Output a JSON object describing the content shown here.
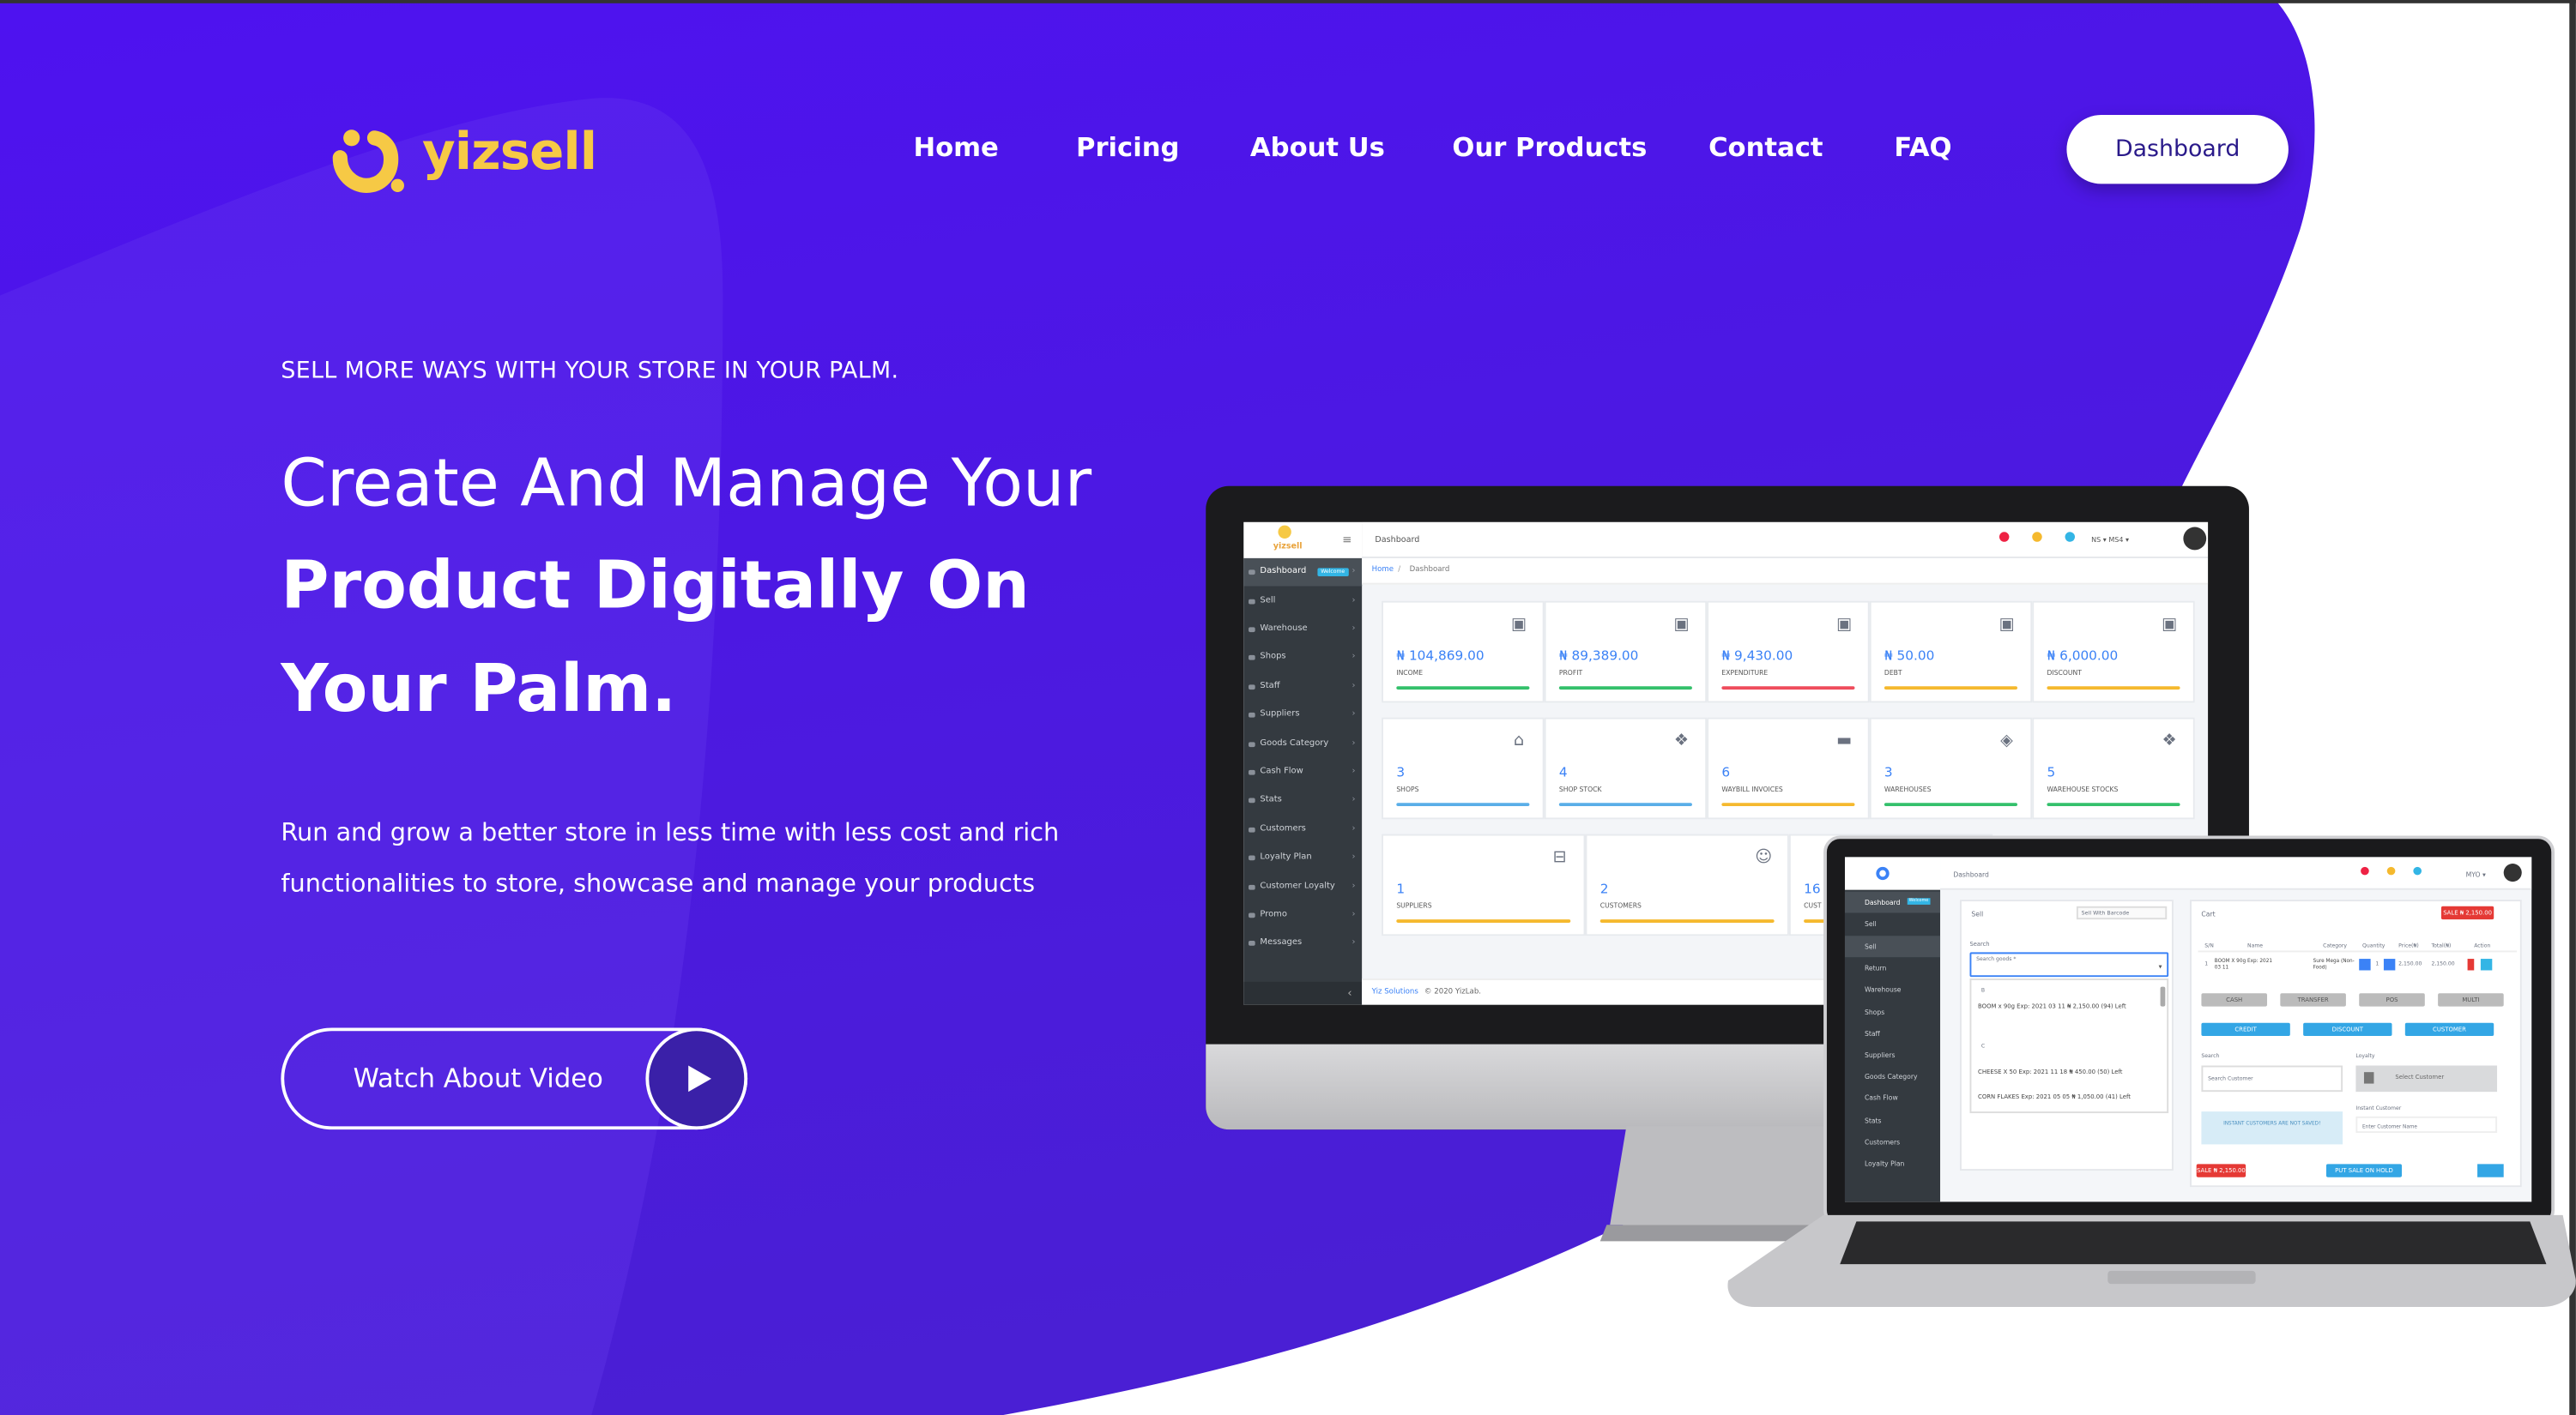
{
  "brand": {
    "name": "yizsell",
    "accent": "#f6c945"
  },
  "colors": {
    "primary": "#4b14e8",
    "button_text": "#2a1a8a"
  },
  "nav": {
    "items": [
      {
        "label": "Home"
      },
      {
        "label": "Pricing"
      },
      {
        "label": "About Us"
      },
      {
        "label": "Our Products"
      },
      {
        "label": "Contact"
      },
      {
        "label": "FAQ"
      }
    ],
    "cta": "Dashboard"
  },
  "hero": {
    "kicker": "SELL MORE WAYS WITH YOUR STORE IN YOUR PALM.",
    "title_line1": "Create And Manage Your",
    "title_line2": "Product Digitally On",
    "title_line3": "Your Palm.",
    "body_line1": "Run and grow a better store in less time with less cost and rich",
    "body_line2": "functionalities to store, showcase and manage your products",
    "video_button": "Watch About Video",
    "play_icon": "play-icon"
  },
  "desktop_app": {
    "logo_text": "yizsell",
    "header_title": "Dashboard",
    "header_right": "NS ▾   MS4 ▾",
    "breadcrumb_home": "Home",
    "breadcrumb_sep": "/",
    "breadcrumb_current": "Dashboard",
    "sidebar": [
      {
        "label": "Dashboard",
        "badge": "Welcome"
      },
      {
        "label": "Sell"
      },
      {
        "label": "Warehouse"
      },
      {
        "label": "Shops"
      },
      {
        "label": "Staff"
      },
      {
        "label": "Suppliers"
      },
      {
        "label": "Goods Category"
      },
      {
        "label": "Cash Flow"
      },
      {
        "label": "Stats"
      },
      {
        "label": "Customers"
      },
      {
        "label": "Loyalty Plan"
      },
      {
        "label": "Customer Loyalty"
      },
      {
        "label": "Promo"
      },
      {
        "label": "Messages"
      }
    ],
    "row1": [
      {
        "value": "₦ 104,869.00",
        "label": "INCOME",
        "color": "#34c06b"
      },
      {
        "value": "₦ 89,389.00",
        "label": "PROFIT",
        "color": "#34c06b"
      },
      {
        "value": "₦ 9,430.00",
        "label": "EXPENDITURE",
        "color": "#ef4c5c"
      },
      {
        "value": "₦ 50.00",
        "label": "DEBT",
        "color": "#f5b92e"
      },
      {
        "value": "₦ 6,000.00",
        "label": "DISCOUNT",
        "color": "#f5b92e"
      }
    ],
    "row2": [
      {
        "value": "3",
        "label": "SHOPS",
        "color": "#5aaee8"
      },
      {
        "value": "4",
        "label": "SHOP STOCK",
        "color": "#5aaee8"
      },
      {
        "value": "6",
        "label": "WAYBILL INVOICES",
        "color": "#f5b92e"
      },
      {
        "value": "3",
        "label": "WAREHOUSES",
        "color": "#34c06b"
      },
      {
        "value": "5",
        "label": "WAREHOUSE STOCKS",
        "color": "#34c06b"
      }
    ],
    "row3": [
      {
        "value": "1",
        "label": "SUPPLIERS",
        "color": "#f5b92e"
      },
      {
        "value": "2",
        "label": "CUSTOMERS",
        "color": "#f5b92e"
      },
      {
        "value": "16",
        "label": "CUST",
        "color": "#f5b92e"
      }
    ],
    "footer_link": "Yiz Solutions",
    "footer_text": "© 2020 YizLab."
  },
  "laptop_app": {
    "header_title": "Dashboard",
    "header_right": "MYO ▾",
    "sidebar": [
      {
        "label": "Dashboard",
        "badge": "Welcome"
      },
      {
        "label": "Sell"
      },
      {
        "label": "Sell"
      },
      {
        "label": "Return"
      },
      {
        "label": "Warehouse"
      },
      {
        "label": "Shops"
      },
      {
        "label": "Staff"
      },
      {
        "label": "Suppliers"
      },
      {
        "label": "Goods Category"
      },
      {
        "label": "Cash Flow"
      },
      {
        "label": "Stats"
      },
      {
        "label": "Customers"
      },
      {
        "label": "Loyalty Plan"
      }
    ],
    "sell_title": "Sell",
    "sell_barcode_placeholder": "Sell With Barcode",
    "search_label": "Search",
    "search_goods_label": "Search goods *",
    "dropdown_items": [
      {
        "group": "B",
        "text": "BOOM x 90g Exp: 2021 03 11 ₦ 2,150.00 (94) Left"
      },
      {
        "group": "C",
        "text": "CHEESE X 50 Exp: 2021 11 18 ₦ 450.00 (50) Left"
      },
      {
        "group": "",
        "text": "CORN FLAKES Exp: 2021 05 05 ₦ 1,050.00 (41) Left"
      }
    ],
    "cart_title": "Cart",
    "cart_total_btn": "SALE ₦ 2,150.00",
    "cart_columns": [
      "S/N",
      "Name",
      "Category",
      "Quantity",
      "Price(₦)",
      "Total(₦)",
      "Action"
    ],
    "cart_row": {
      "sn": "1",
      "name": "BOOM X 90g Exp: 2021 03 11",
      "category": "Sure Mega (Non-Food)",
      "qty": "1",
      "price": "2,150.00",
      "total": "2,150.00"
    },
    "pay_buttons": [
      "CASH",
      "TRANSFER",
      "POS",
      "MULTI"
    ],
    "action_buttons": [
      "CREDIT",
      "DISCOUNT",
      "CUSTOMER"
    ],
    "customer_search_label": "Search",
    "customer_search_placeholder": "Search Customer",
    "loyalty_label": "Loyalty",
    "select_customer": "Select Customer",
    "instant_customer_label": "Instant Customer",
    "instant_customer_placeholder": "Enter Customer Name",
    "notice": "INSTANT CUSTOMERS ARE NOT SAVED!",
    "bottom_sale": "SALE ₦ 2,150.00",
    "bottom_hold": "PUT SALE ON HOLD"
  }
}
